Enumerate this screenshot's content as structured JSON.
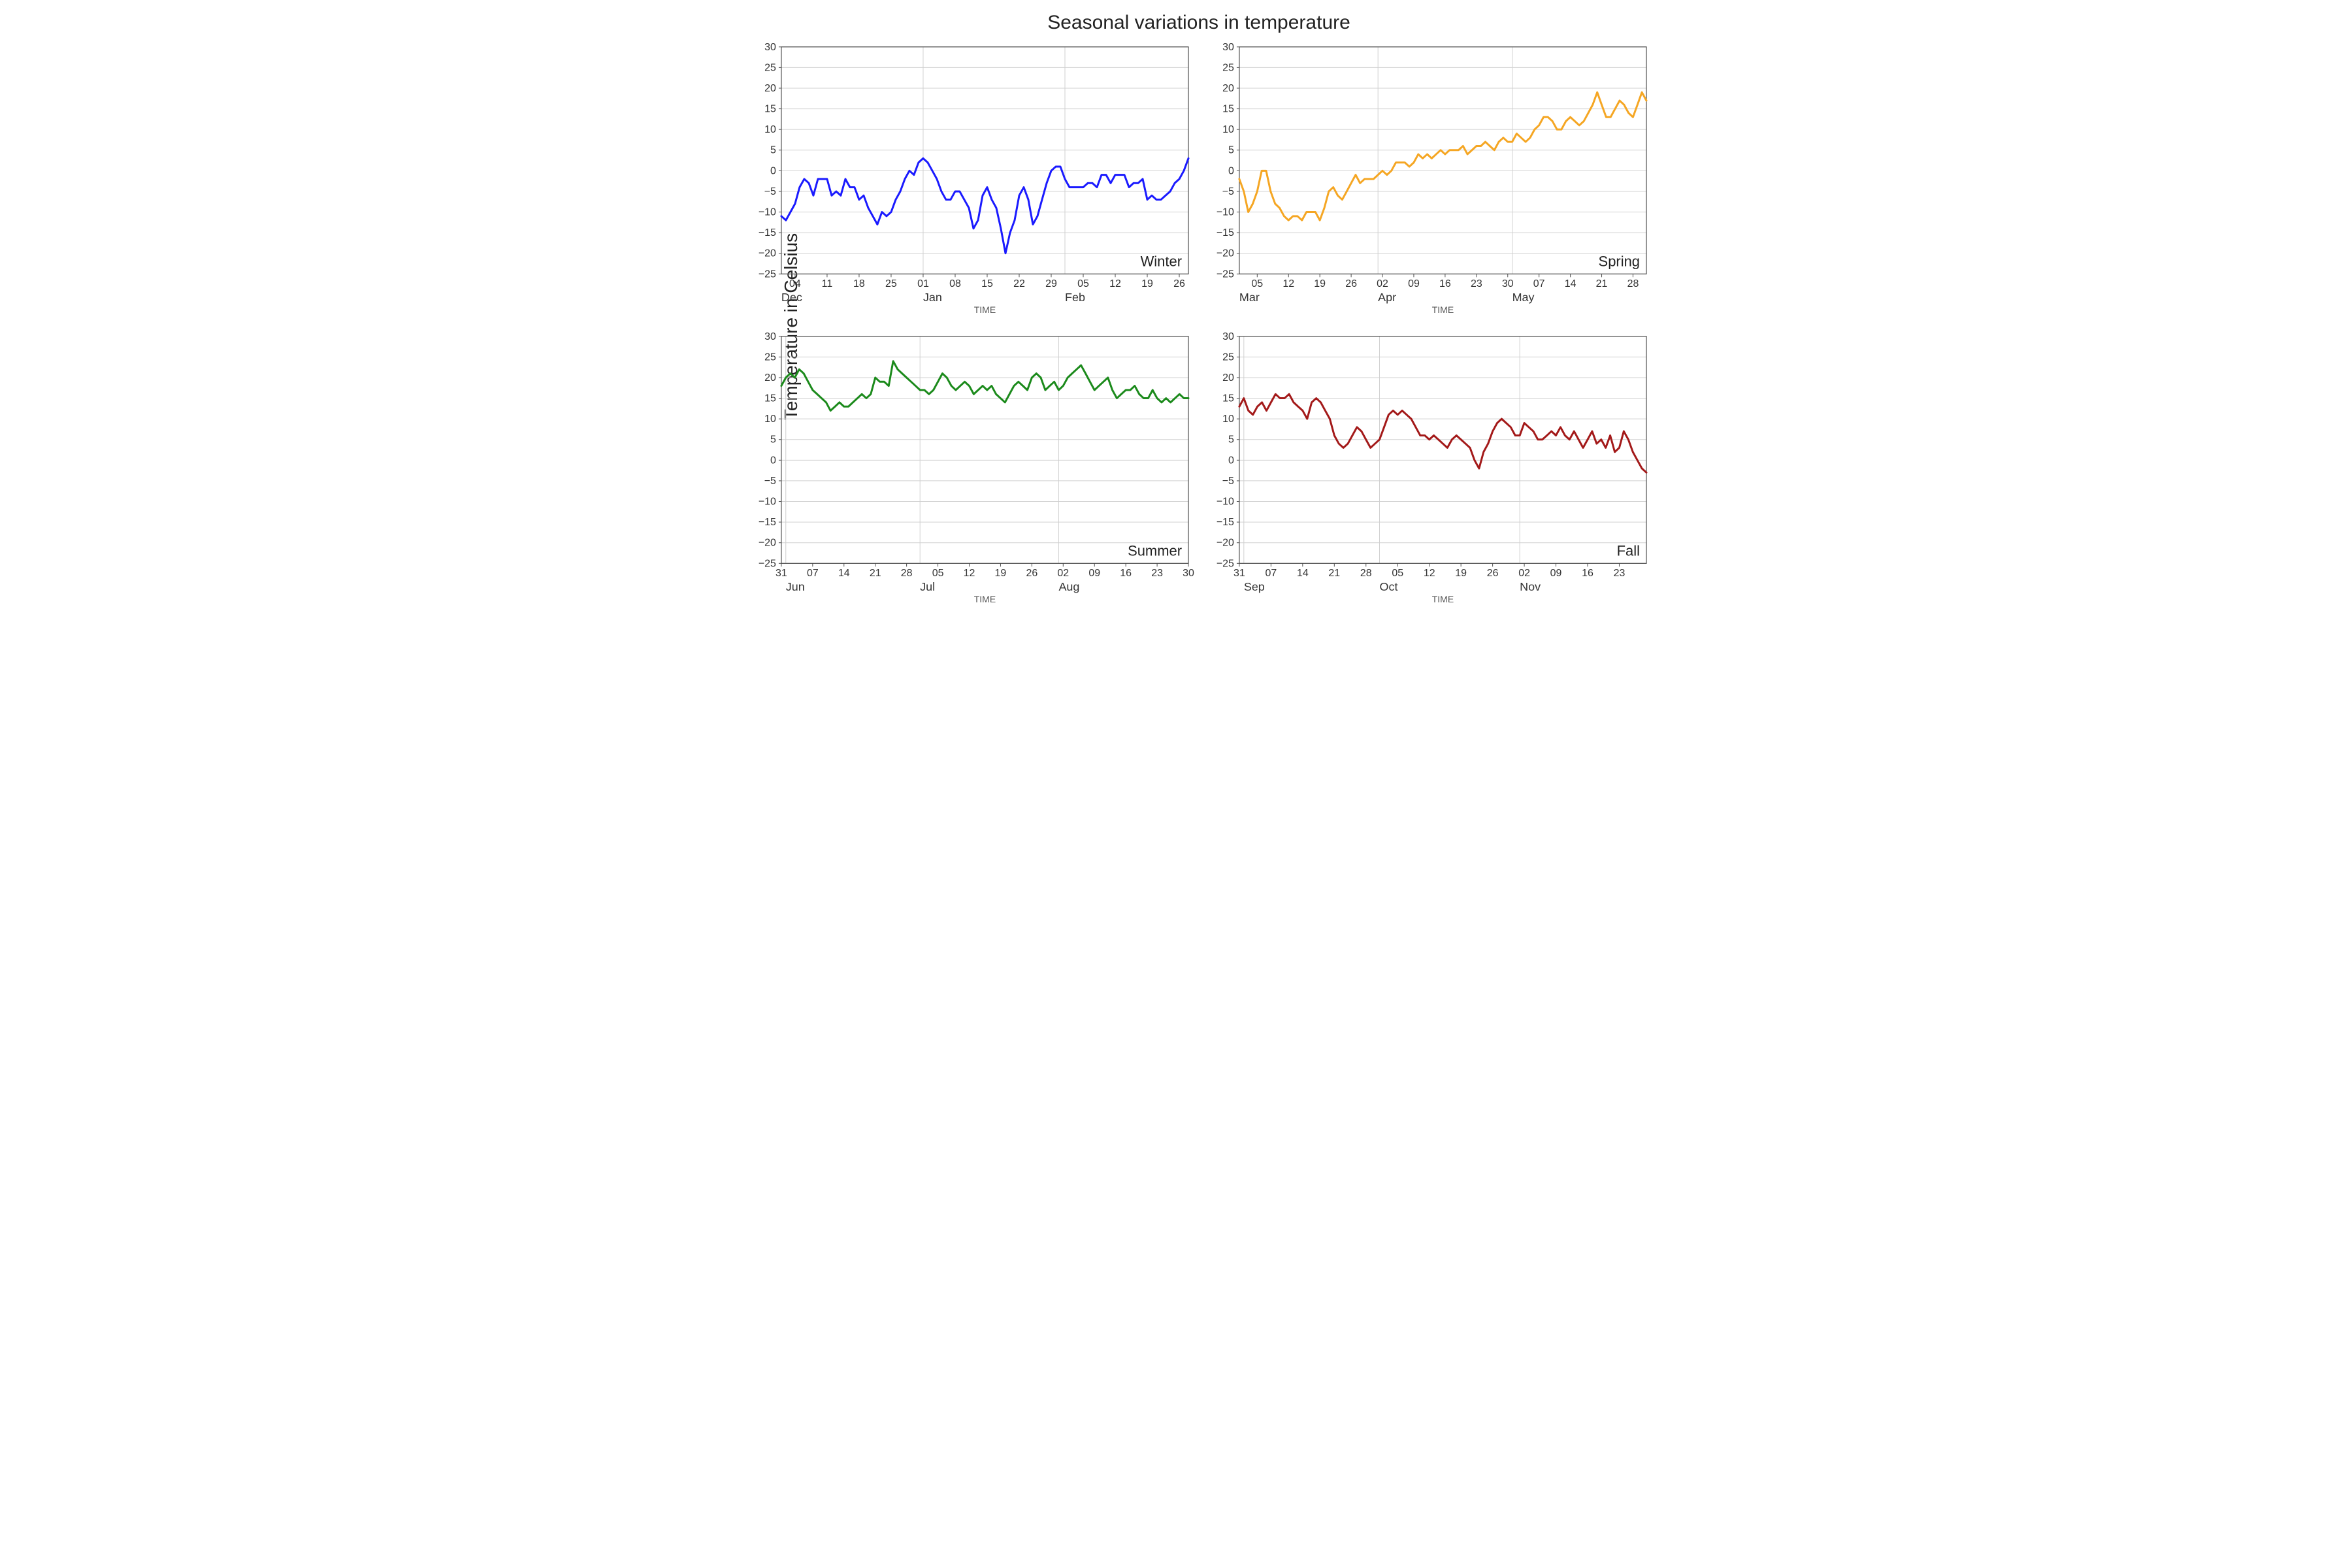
{
  "title": "Seasonal variations in temperature",
  "ylabel": "Temperature in Celsius",
  "xlabel": "TIME",
  "ylim": [
    -25,
    30
  ],
  "yticks": [
    -25,
    -20,
    -15,
    -10,
    -5,
    0,
    5,
    10,
    15,
    20,
    25,
    30
  ],
  "panels": [
    {
      "key": "winter",
      "label": "Winter",
      "color": "#1a1aff",
      "months": [
        "Dec",
        "Jan",
        "Feb"
      ],
      "month_start_idx": [
        0,
        31,
        62
      ],
      "day_ticks": [
        "04",
        "11",
        "18",
        "25",
        "01",
        "08",
        "15",
        "22",
        "29",
        "05",
        "12",
        "19",
        "26"
      ],
      "day_tick_idx": [
        3,
        10,
        17,
        24,
        31,
        38,
        45,
        52,
        59,
        66,
        73,
        80,
        87
      ],
      "n": 90
    },
    {
      "key": "spring",
      "label": "Spring",
      "color": "#f5a623",
      "months": [
        "Mar",
        "Apr",
        "May"
      ],
      "month_start_idx": [
        0,
        31,
        61
      ],
      "day_ticks": [
        "05",
        "12",
        "19",
        "26",
        "02",
        "09",
        "16",
        "23",
        "30",
        "07",
        "14",
        "21",
        "28"
      ],
      "day_tick_idx": [
        4,
        11,
        18,
        25,
        32,
        39,
        46,
        53,
        60,
        67,
        74,
        81,
        88
      ],
      "n": 92
    },
    {
      "key": "summer",
      "label": "Summer",
      "color": "#1b8a1b",
      "months": [
        "Jun",
        "Jul",
        "Aug"
      ],
      "month_start_idx": [
        1,
        31,
        62
      ],
      "day_ticks": [
        "31",
        "07",
        "14",
        "21",
        "28",
        "05",
        "12",
        "19",
        "26",
        "02",
        "09",
        "16",
        "23",
        "30"
      ],
      "day_tick_idx": [
        0,
        7,
        14,
        21,
        28,
        35,
        42,
        49,
        56,
        63,
        70,
        77,
        84,
        91
      ],
      "n": 92
    },
    {
      "key": "fall",
      "label": "Fall",
      "color": "#a31919",
      "months": [
        "Sep",
        "Oct",
        "Nov"
      ],
      "month_start_idx": [
        1,
        31,
        62
      ],
      "day_ticks": [
        "31",
        "07",
        "14",
        "21",
        "28",
        "05",
        "12",
        "19",
        "26",
        "02",
        "09",
        "16",
        "23"
      ],
      "day_tick_idx": [
        0,
        7,
        14,
        21,
        28,
        35,
        42,
        49,
        56,
        63,
        70,
        77,
        84
      ],
      "n": 91
    }
  ],
  "chart_data": [
    {
      "type": "line",
      "title": "Winter",
      "xlabel": "TIME",
      "ylabel": "Temperature in Celsius",
      "ylim": [
        -25,
        30
      ],
      "x": [
        "Dec 01",
        "Dec 02",
        "Dec 03",
        "Dec 04",
        "Dec 05",
        "Dec 06",
        "Dec 07",
        "Dec 08",
        "Dec 09",
        "Dec 10",
        "Dec 11",
        "Dec 12",
        "Dec 13",
        "Dec 14",
        "Dec 15",
        "Dec 16",
        "Dec 17",
        "Dec 18",
        "Dec 19",
        "Dec 20",
        "Dec 21",
        "Dec 22",
        "Dec 23",
        "Dec 24",
        "Dec 25",
        "Dec 26",
        "Dec 27",
        "Dec 28",
        "Dec 29",
        "Dec 30",
        "Dec 31",
        "Jan 01",
        "Jan 02",
        "Jan 03",
        "Jan 04",
        "Jan 05",
        "Jan 06",
        "Jan 07",
        "Jan 08",
        "Jan 09",
        "Jan 10",
        "Jan 11",
        "Jan 12",
        "Jan 13",
        "Jan 14",
        "Jan 15",
        "Jan 16",
        "Jan 17",
        "Jan 18",
        "Jan 19",
        "Jan 20",
        "Jan 21",
        "Jan 22",
        "Jan 23",
        "Jan 24",
        "Jan 25",
        "Jan 26",
        "Jan 27",
        "Jan 28",
        "Jan 29",
        "Jan 30",
        "Jan 31",
        "Feb 01",
        "Feb 02",
        "Feb 03",
        "Feb 04",
        "Feb 05",
        "Feb 06",
        "Feb 07",
        "Feb 08",
        "Feb 09",
        "Feb 10",
        "Feb 11",
        "Feb 12",
        "Feb 13",
        "Feb 14",
        "Feb 15",
        "Feb 16",
        "Feb 17",
        "Feb 18",
        "Feb 19",
        "Feb 20",
        "Feb 21",
        "Feb 22",
        "Feb 23",
        "Feb 24",
        "Feb 25",
        "Feb 26",
        "Feb 27",
        "Feb 28"
      ],
      "values": [
        -11,
        -12,
        -10,
        -8,
        -4,
        -2,
        -3,
        -6,
        -2,
        -2,
        -2,
        -6,
        -5,
        -6,
        -2,
        -4,
        -4,
        -7,
        -6,
        -9,
        -11,
        -13,
        -10,
        -11,
        -10,
        -7,
        -5,
        -2,
        0,
        -1,
        2,
        3,
        2,
        0,
        -2,
        -5,
        -7,
        -7,
        -5,
        -5,
        -7,
        -9,
        -14,
        -12,
        -6,
        -4,
        -7,
        -9,
        -14,
        -20,
        -15,
        -12,
        -6,
        -4,
        -7,
        -13,
        -11,
        -7,
        -3,
        0,
        1,
        1,
        -2,
        -4,
        -4,
        -4,
        -4,
        -3,
        -3,
        -4,
        -1,
        -1,
        -3,
        -1,
        -1,
        -1,
        -4,
        -3,
        -3,
        -2,
        -7,
        -6,
        -7,
        -7,
        -6,
        -5,
        -3,
        -2,
        0,
        3
      ]
    },
    {
      "type": "line",
      "title": "Spring",
      "xlabel": "TIME",
      "ylabel": "Temperature in Celsius",
      "ylim": [
        -25,
        30
      ],
      "x": [
        "Mar 01",
        "Mar 02",
        "Mar 03",
        "Mar 04",
        "Mar 05",
        "Mar 06",
        "Mar 07",
        "Mar 08",
        "Mar 09",
        "Mar 10",
        "Mar 11",
        "Mar 12",
        "Mar 13",
        "Mar 14",
        "Mar 15",
        "Mar 16",
        "Mar 17",
        "Mar 18",
        "Mar 19",
        "Mar 20",
        "Mar 21",
        "Mar 22",
        "Mar 23",
        "Mar 24",
        "Mar 25",
        "Mar 26",
        "Mar 27",
        "Mar 28",
        "Mar 29",
        "Mar 30",
        "Mar 31",
        "Apr 01",
        "Apr 02",
        "Apr 03",
        "Apr 04",
        "Apr 05",
        "Apr 06",
        "Apr 07",
        "Apr 08",
        "Apr 09",
        "Apr 10",
        "Apr 11",
        "Apr 12",
        "Apr 13",
        "Apr 14",
        "Apr 15",
        "Apr 16",
        "Apr 17",
        "Apr 18",
        "Apr 19",
        "Apr 20",
        "Apr 21",
        "Apr 22",
        "Apr 23",
        "Apr 24",
        "Apr 25",
        "Apr 26",
        "Apr 27",
        "Apr 28",
        "Apr 29",
        "Apr 30",
        "May 01",
        "May 02",
        "May 03",
        "May 04",
        "May 05",
        "May 06",
        "May 07",
        "May 08",
        "May 09",
        "May 10",
        "May 11",
        "May 12",
        "May 13",
        "May 14",
        "May 15",
        "May 16",
        "May 17",
        "May 18",
        "May 19",
        "May 20",
        "May 21",
        "May 22",
        "May 23",
        "May 24",
        "May 25",
        "May 26",
        "May 27",
        "May 28",
        "May 29",
        "May 30",
        "May 31"
      ],
      "values": [
        -2,
        -5,
        -10,
        -8,
        -5,
        0,
        0,
        -5,
        -8,
        -9,
        -11,
        -12,
        -11,
        -11,
        -12,
        -10,
        -10,
        -10,
        -12,
        -9,
        -5,
        -4,
        -6,
        -7,
        -5,
        -3,
        -1,
        -3,
        -2,
        -2,
        -2,
        -1,
        0,
        -1,
        0,
        2,
        2,
        2,
        1,
        2,
        4,
        3,
        4,
        3,
        4,
        5,
        4,
        5,
        5,
        5,
        6,
        4,
        5,
        6,
        6,
        7,
        6,
        5,
        7,
        8,
        7,
        7,
        9,
        8,
        7,
        8,
        10,
        11,
        13,
        13,
        12,
        10,
        10,
        12,
        13,
        12,
        11,
        12,
        14,
        16,
        19,
        16,
        13,
        13,
        15,
        17,
        16,
        14,
        13,
        16,
        19,
        17
      ]
    },
    {
      "type": "line",
      "title": "Summer",
      "xlabel": "TIME",
      "ylabel": "Temperature in Celsius",
      "ylim": [
        -25,
        30
      ],
      "x": [
        "May 31",
        "Jun 01",
        "Jun 02",
        "Jun 03",
        "Jun 04",
        "Jun 05",
        "Jun 06",
        "Jun 07",
        "Jun 08",
        "Jun 09",
        "Jun 10",
        "Jun 11",
        "Jun 12",
        "Jun 13",
        "Jun 14",
        "Jun 15",
        "Jun 16",
        "Jun 17",
        "Jun 18",
        "Jun 19",
        "Jun 20",
        "Jun 21",
        "Jun 22",
        "Jun 23",
        "Jun 24",
        "Jun 25",
        "Jun 26",
        "Jun 27",
        "Jun 28",
        "Jun 29",
        "Jun 30",
        "Jul 01",
        "Jul 02",
        "Jul 03",
        "Jul 04",
        "Jul 05",
        "Jul 06",
        "Jul 07",
        "Jul 08",
        "Jul 09",
        "Jul 10",
        "Jul 11",
        "Jul 12",
        "Jul 13",
        "Jul 14",
        "Jul 15",
        "Jul 16",
        "Jul 17",
        "Jul 18",
        "Jul 19",
        "Jul 20",
        "Jul 21",
        "Jul 22",
        "Jul 23",
        "Jul 24",
        "Jul 25",
        "Jul 26",
        "Jul 27",
        "Jul 28",
        "Jul 29",
        "Jul 30",
        "Jul 31",
        "Aug 01",
        "Aug 02",
        "Aug 03",
        "Aug 04",
        "Aug 05",
        "Aug 06",
        "Aug 07",
        "Aug 08",
        "Aug 09",
        "Aug 10",
        "Aug 11",
        "Aug 12",
        "Aug 13",
        "Aug 14",
        "Aug 15",
        "Aug 16",
        "Aug 17",
        "Aug 18",
        "Aug 19",
        "Aug 20",
        "Aug 21",
        "Aug 22",
        "Aug 23",
        "Aug 24",
        "Aug 25",
        "Aug 26",
        "Aug 27",
        "Aug 28",
        "Aug 29",
        "Aug 30"
      ],
      "values": [
        18,
        20,
        21,
        20,
        22,
        21,
        19,
        17,
        16,
        15,
        14,
        12,
        13,
        14,
        13,
        13,
        14,
        15,
        16,
        15,
        16,
        20,
        19,
        19,
        18,
        24,
        22,
        21,
        20,
        19,
        18,
        17,
        17,
        16,
        17,
        19,
        21,
        20,
        18,
        17,
        18,
        19,
        18,
        16,
        17,
        18,
        17,
        18,
        16,
        15,
        14,
        16,
        18,
        19,
        18,
        17,
        20,
        21,
        20,
        17,
        18,
        19,
        17,
        18,
        20,
        21,
        22,
        23,
        21,
        19,
        17,
        18,
        19,
        20,
        17,
        15,
        16,
        17,
        17,
        18,
        16,
        15,
        15,
        17,
        15,
        14,
        15,
        14,
        15,
        16,
        15,
        15
      ]
    },
    {
      "type": "line",
      "title": "Fall",
      "xlabel": "TIME",
      "ylabel": "Temperature in Celsius",
      "ylim": [
        -25,
        30
      ],
      "x": [
        "Aug 31",
        "Sep 01",
        "Sep 02",
        "Sep 03",
        "Sep 04",
        "Sep 05",
        "Sep 06",
        "Sep 07",
        "Sep 08",
        "Sep 09",
        "Sep 10",
        "Sep 11",
        "Sep 12",
        "Sep 13",
        "Sep 14",
        "Sep 15",
        "Sep 16",
        "Sep 17",
        "Sep 18",
        "Sep 19",
        "Sep 20",
        "Sep 21",
        "Sep 22",
        "Sep 23",
        "Sep 24",
        "Sep 25",
        "Sep 26",
        "Sep 27",
        "Sep 28",
        "Sep 29",
        "Sep 30",
        "Oct 01",
        "Oct 02",
        "Oct 03",
        "Oct 04",
        "Oct 05",
        "Oct 06",
        "Oct 07",
        "Oct 08",
        "Oct 09",
        "Oct 10",
        "Oct 11",
        "Oct 12",
        "Oct 13",
        "Oct 14",
        "Oct 15",
        "Oct 16",
        "Oct 17",
        "Oct 18",
        "Oct 19",
        "Oct 20",
        "Oct 21",
        "Oct 22",
        "Oct 23",
        "Oct 24",
        "Oct 25",
        "Oct 26",
        "Oct 27",
        "Oct 28",
        "Oct 29",
        "Oct 30",
        "Oct 31",
        "Nov 01",
        "Nov 02",
        "Nov 03",
        "Nov 04",
        "Nov 05",
        "Nov 06",
        "Nov 07",
        "Nov 08",
        "Nov 09",
        "Nov 10",
        "Nov 11",
        "Nov 12",
        "Nov 13",
        "Nov 14",
        "Nov 15",
        "Nov 16",
        "Nov 17",
        "Nov 18",
        "Nov 19",
        "Nov 20",
        "Nov 21",
        "Nov 22",
        "Nov 23",
        "Nov 24",
        "Nov 25",
        "Nov 26",
        "Nov 27",
        "Nov 28",
        "Nov 29"
      ],
      "values": [
        13,
        15,
        12,
        11,
        13,
        14,
        12,
        14,
        16,
        15,
        15,
        16,
        14,
        13,
        12,
        10,
        14,
        15,
        14,
        12,
        10,
        6,
        4,
        3,
        4,
        6,
        8,
        7,
        5,
        3,
        4,
        5,
        8,
        11,
        12,
        11,
        12,
        11,
        10,
        8,
        6,
        6,
        5,
        6,
        5,
        4,
        3,
        5,
        6,
        5,
        4,
        3,
        0,
        -2,
        2,
        4,
        7,
        9,
        10,
        9,
        8,
        6,
        6,
        9,
        8,
        7,
        5,
        5,
        6,
        7,
        6,
        8,
        6,
        5,
        7,
        5,
        3,
        5,
        7,
        4,
        5,
        3,
        6,
        2,
        3,
        7,
        5,
        2,
        0,
        -2,
        -3
      ]
    }
  ]
}
